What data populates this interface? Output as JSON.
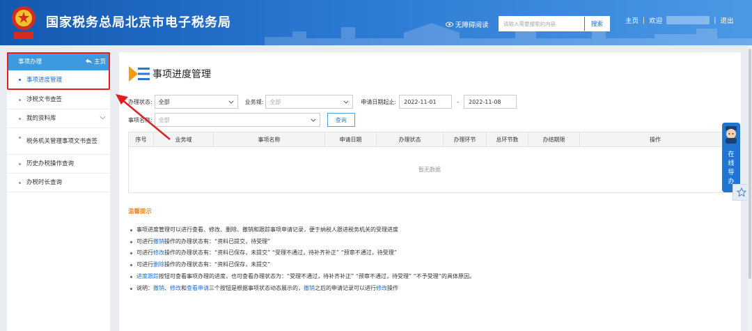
{
  "header": {
    "title": "国家税务总局北京市电子税务局",
    "accessibility_label": "无障碍阅读",
    "search_placeholder": "请输入需要搜索的内容",
    "search_button": "搜索",
    "home_link": "主页",
    "welcome": "欢迎",
    "logout": "退出",
    "emblem_caption": "中国税务"
  },
  "sidebar": {
    "section_title": "事项办理",
    "home_label": "主页",
    "items": [
      "事项进度管理",
      "涉税文书查签",
      "我的资料库",
      "税务机关管理事项文书查签",
      "历史办税操作查询",
      "办税时长查询"
    ]
  },
  "main": {
    "page_title": "事项进度管理",
    "filters": {
      "status_label": "办理状态:",
      "status_value": "全部",
      "domain_label": "业务域:",
      "domain_value": "全部",
      "date_label": "申请日期起止:",
      "date_from": "2022-11-01",
      "date_sep": "-",
      "date_to": "2022-11-08",
      "name_label": "事项名称:",
      "name_value": "全部",
      "query_button": "查询"
    },
    "table": {
      "columns": [
        "序号",
        "业务域",
        "事项名称",
        "申请日期",
        "办理状态",
        "办理环节",
        "总环节数",
        "办结期限",
        "操作"
      ],
      "empty_text": "暂无数据"
    },
    "tips": {
      "title": "温馨提示",
      "t1": "事项进度管理可以进行查看、修改、删除、撤销和跟踪事项申请记录，便于纳税人跟进税务机关的受理进度",
      "t2_a": "可进行",
      "t2_link": "撤销",
      "t2_b": "操作的办理状态有：“资料已提交，待受理”",
      "t3_a": "可进行",
      "t3_link": "修改",
      "t3_b": "操作的办理状态有：“资料已保存，未提交”  “受理不通过，待补齐补正”  “预审不通过，待受理”",
      "t4_a": "可进行",
      "t4_link": "删除",
      "t4_b": "操作的办理状态有：“资料已保存，未提交”",
      "t5_link": "进度跟踪",
      "t5_b": "按钮可查看事项办理的进度，也可查看办理状态为：“受理不通过，待补齐补正”  “预审不通过，待受理”  “不予受理”的具体原因。",
      "t6_a": "说明：",
      "t6_l1": "撤销",
      "t6_s1": "、",
      "t6_l2": "修改",
      "t6_s2": "和",
      "t6_l3": "查看申请",
      "t6_b": "三个按钮是根据事项状态动态展示的，",
      "t6_l4": "撤销",
      "t6_c": "之后的申请记录可以进行",
      "t6_l5": "修改",
      "t6_d": "操作"
    }
  },
  "guide": {
    "text": "在线导办"
  },
  "colors": {
    "header": "#2b78d3",
    "accent": "#1f6fcf",
    "highlight": "#e02020",
    "tips_title": "#f08a1e"
  }
}
